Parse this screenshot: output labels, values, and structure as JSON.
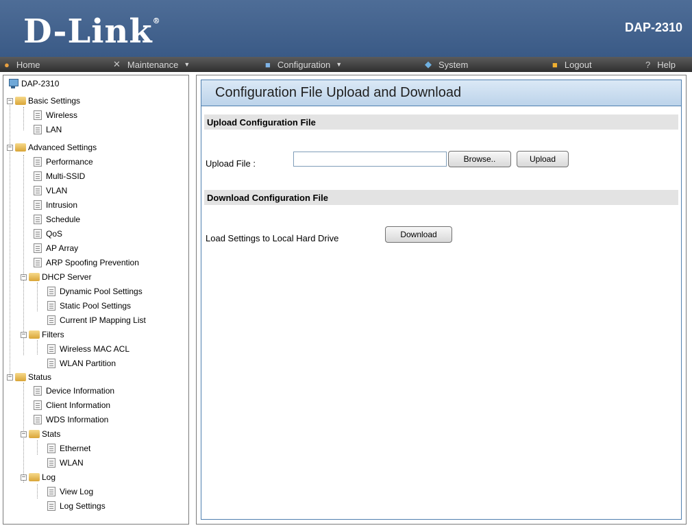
{
  "header": {
    "logo_text": "D-Link",
    "logo_registered": "®",
    "model": "DAP-2310"
  },
  "menu": {
    "home": "Home",
    "maintenance": "Maintenance",
    "configuration": "Configuration",
    "system": "System",
    "logout": "Logout",
    "help": "Help",
    "dropdown_caret": "▼"
  },
  "tree": {
    "root": "DAP-2310",
    "basic_settings": "Basic Settings",
    "wireless": "Wireless",
    "lan": "LAN",
    "advanced_settings": "Advanced Settings",
    "performance": "Performance",
    "multi_ssid": "Multi-SSID",
    "vlan": "VLAN",
    "intrusion": "Intrusion",
    "schedule": "Schedule",
    "qos": "QoS",
    "ap_array": "AP Array",
    "arp_spoofing": "ARP Spoofing Prevention",
    "dhcp_server": "DHCP Server",
    "dynamic_pool": "Dynamic Pool Settings",
    "static_pool": "Static Pool Settings",
    "ip_mapping": "Current IP Mapping List",
    "filters": "Filters",
    "wireless_mac_acl": "Wireless MAC ACL",
    "wlan_partition": "WLAN Partition",
    "status": "Status",
    "device_info": "Device Information",
    "client_info": "Client Information",
    "wds_info": "WDS Information",
    "stats": "Stats",
    "ethernet": "Ethernet",
    "wlan": "WLAN",
    "log": "Log",
    "view_log": "View Log",
    "log_settings": "Log Settings",
    "collapse_symbol": "−"
  },
  "content": {
    "title": "Configuration File Upload and Download",
    "upload_section": "Upload Configuration File",
    "upload_label": "Upload File :",
    "upload_value": "",
    "browse_button": "Browse..",
    "upload_button": "Upload",
    "download_section": "Download Configuration File",
    "download_label": "Load Settings to Local Hard Drive",
    "download_button": "Download"
  },
  "colors": {
    "header_blue": "#3a5a86",
    "menubar": "#3c3c3c",
    "panel_title_bg": "#c9dcef",
    "section_bg": "#e3e3e3"
  }
}
